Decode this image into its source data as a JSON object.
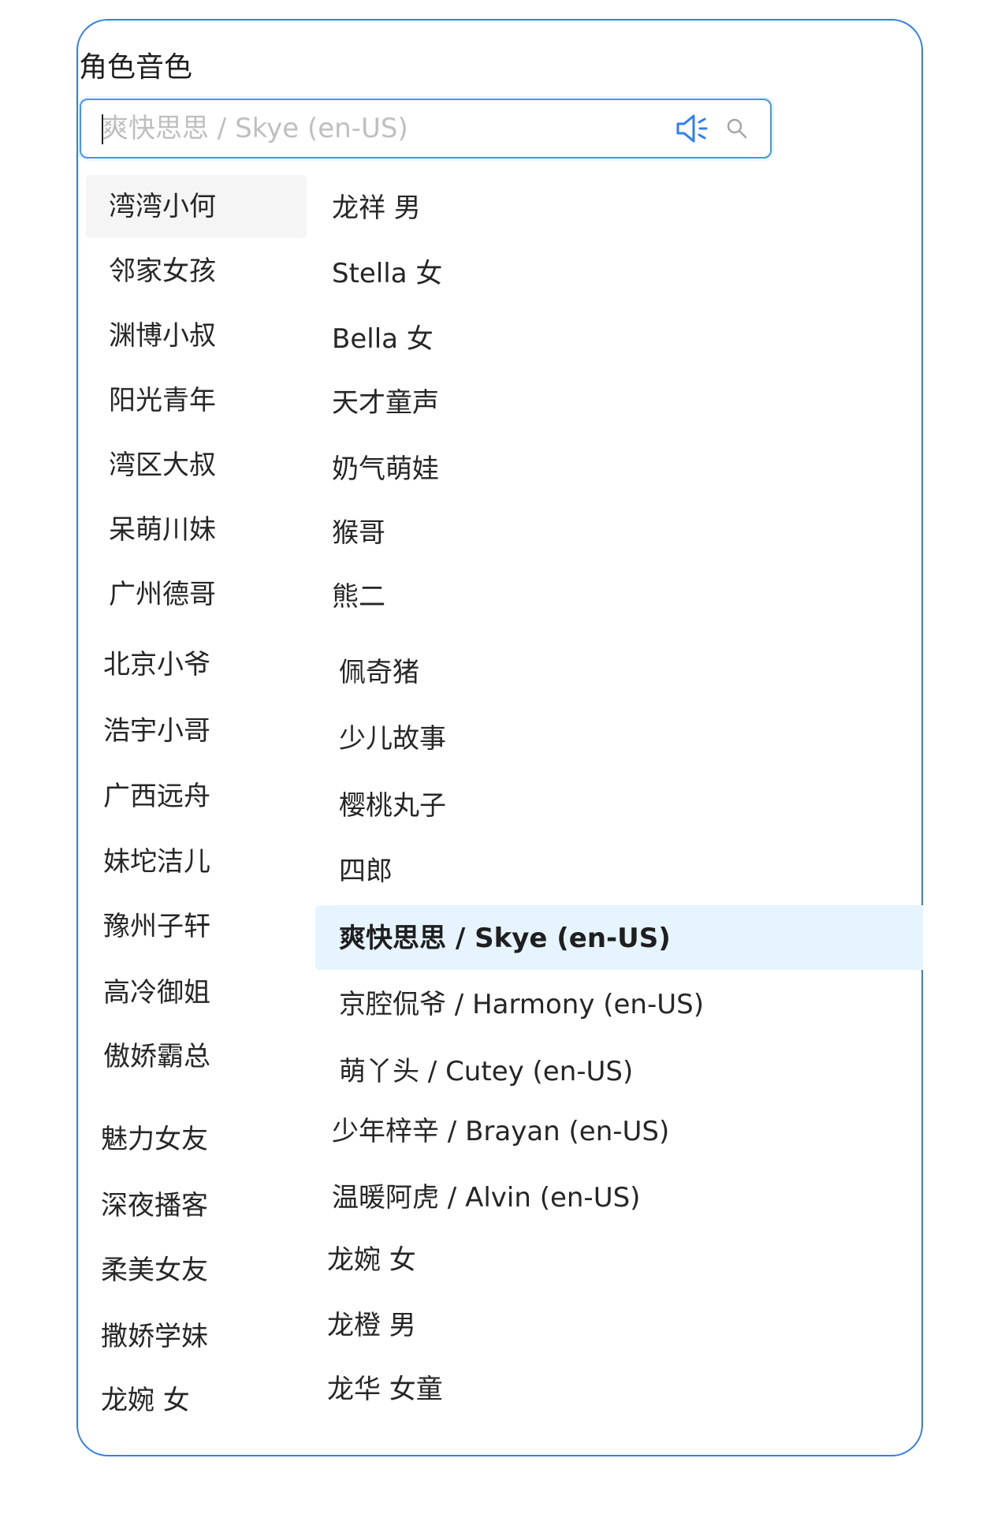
{
  "field": {
    "label": "角色音色",
    "placeholder": "爽快思思 / Skye (en-US)",
    "value": ""
  },
  "icons": {
    "speaker": "speaker-icon",
    "search": "search-icon",
    "accent_color": "#2f80ed"
  },
  "options": {
    "left_column": [
      "湾湾小何",
      "邻家女孩",
      "渊博小叔",
      "阳光青年",
      "湾区大叔",
      "呆萌川妹",
      "广州德哥",
      "北京小爷",
      "浩宇小哥",
      "广西远舟",
      "妹坨洁儿",
      "豫州子轩",
      "高冷御姐",
      "傲娇霸总",
      "魅力女友",
      "深夜播客",
      "柔美女友",
      "撒娇学妹",
      "龙婉 女"
    ],
    "right_column": [
      "龙祥 男",
      "Stella 女",
      "Bella 女",
      "天才童声",
      "奶气萌娃",
      "猴哥",
      "熊二",
      "佩奇猪",
      "少儿故事",
      "樱桃丸子",
      "四郎",
      "爽快思思 / Skye (en-US)",
      "京腔侃爷 / Harmony (en-US)",
      "萌丫头 / Cutey (en-US)",
      "少年梓辛 / Brayan (en-US)",
      "温暖阿虎 / Alvin (en-US)",
      "龙婉 女",
      "龙橙 男",
      "龙华 女童"
    ],
    "active_left": "湾湾小何",
    "selected_right": "爽快思思 / Skye (en-US)"
  }
}
